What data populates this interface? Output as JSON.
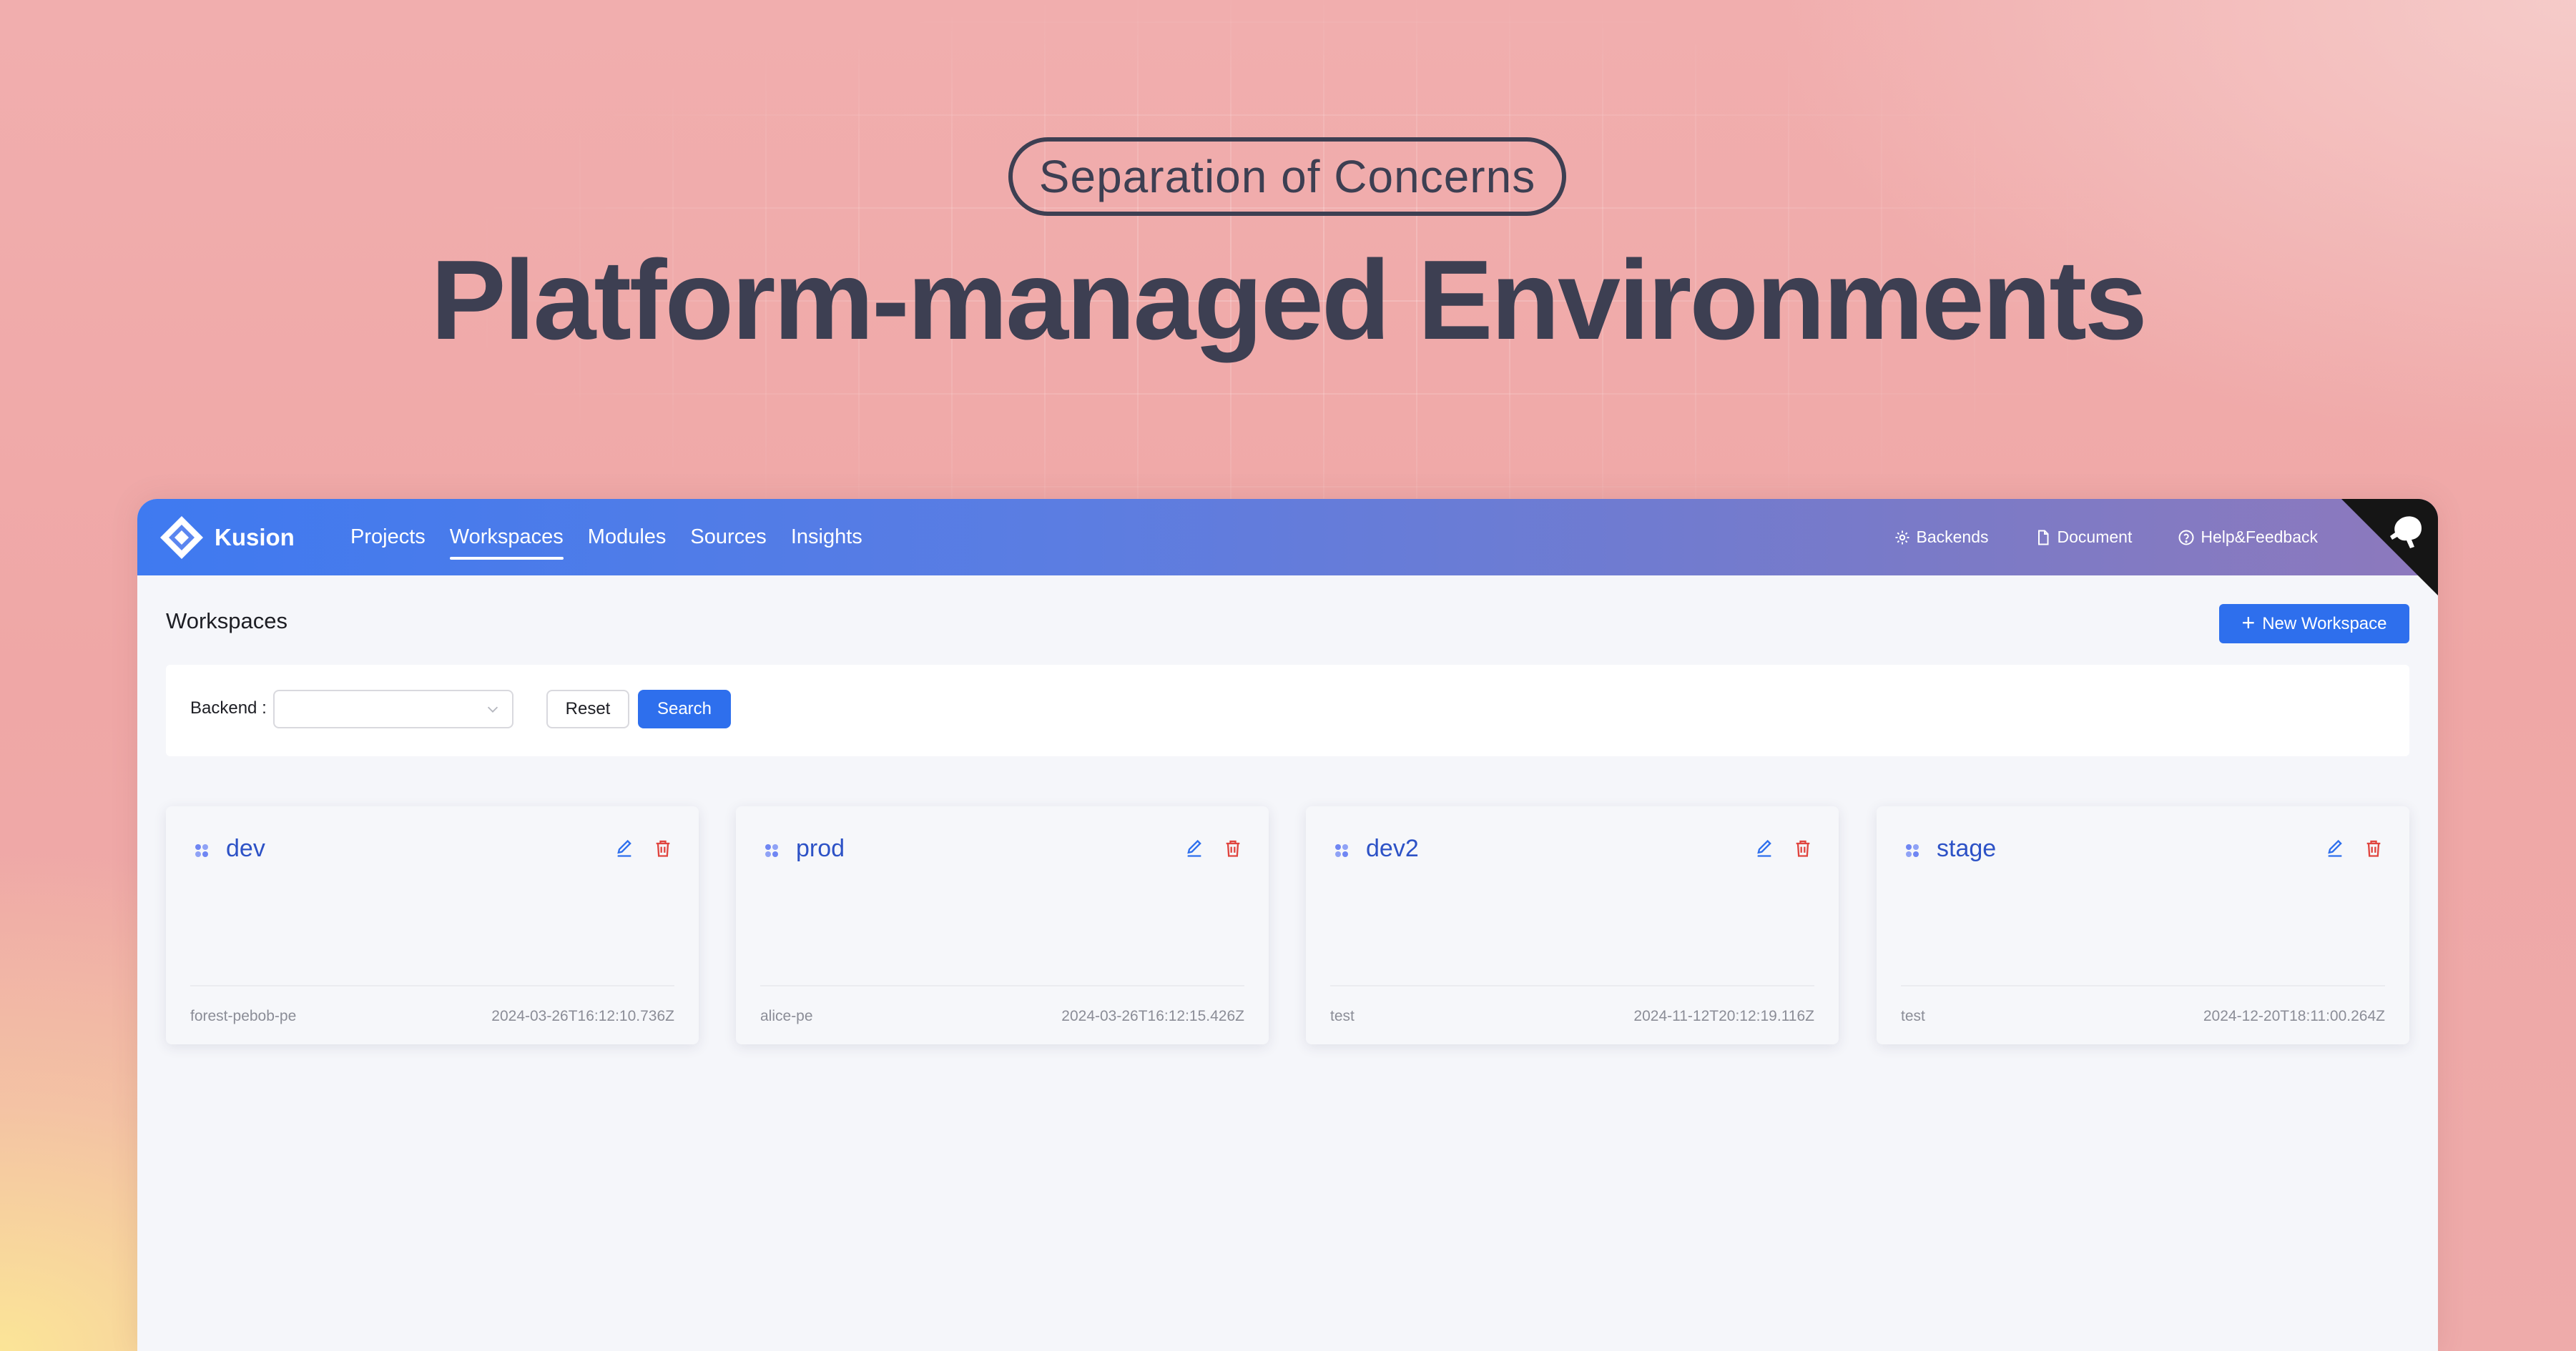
{
  "hero": {
    "pill": "Separation of Concerns",
    "title": "Platform-managed Environments"
  },
  "app": {
    "brand": "Kusion",
    "nav": [
      "Projects",
      "Workspaces",
      "Modules",
      "Sources",
      "Insights"
    ],
    "nav_active": "Workspaces",
    "right_links": [
      {
        "label": "Backends",
        "icon": "gear-icon"
      },
      {
        "label": "Document",
        "icon": "document-icon"
      },
      {
        "label": "Help&Feedback",
        "icon": "help-icon"
      }
    ],
    "colors": {
      "primary": "#2e6fed",
      "accent_link": "#2d52c6",
      "delete": "#e0453f"
    }
  },
  "page": {
    "title": "Workspaces",
    "new_button": "New Workspace"
  },
  "filter": {
    "backend_label": "Backend",
    "backend_value": "",
    "reset_label": "Reset",
    "search_label": "Search"
  },
  "workspaces": [
    {
      "name": "dev",
      "owner": "forest-pebob-pe",
      "created": "2024-03-26T16:12:10.736Z"
    },
    {
      "name": "prod",
      "owner": "alice-pe",
      "created": "2024-03-26T16:12:15.426Z"
    },
    {
      "name": "dev2",
      "owner": "test",
      "created": "2024-11-12T20:12:19.116Z"
    },
    {
      "name": "stage",
      "owner": "test",
      "created": "2024-12-20T18:11:00.264Z"
    }
  ]
}
